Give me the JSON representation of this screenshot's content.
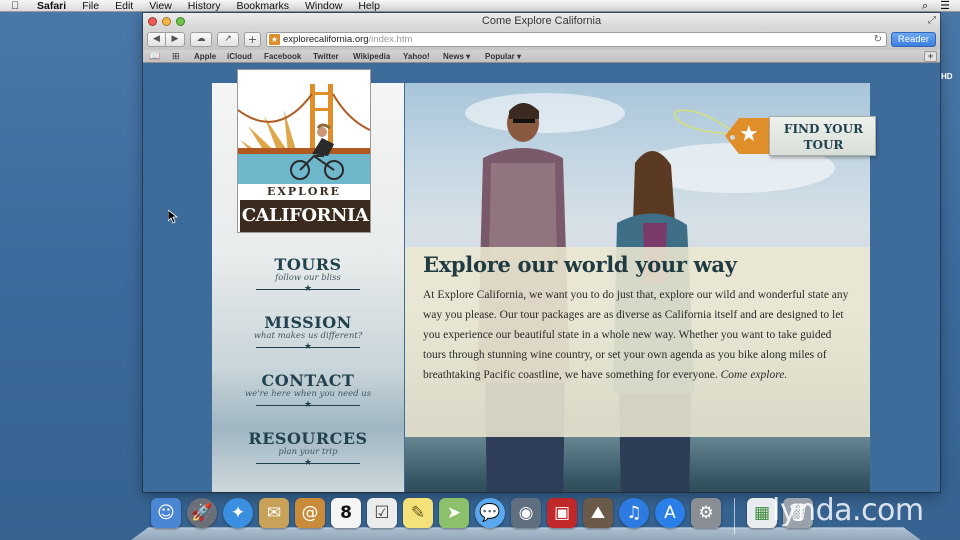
{
  "menubar": {
    "app": "Safari",
    "items": [
      "File",
      "Edit",
      "View",
      "History",
      "Bookmarks",
      "Window",
      "Help"
    ]
  },
  "window": {
    "title": "Come Explore California",
    "url_host": "explorecalifornia.org",
    "url_path": "/index.htm",
    "reader_label": "Reader",
    "new_tab_label": "+",
    "bookmarks": [
      "Apple",
      "iCloud",
      "Facebook",
      "Twitter",
      "Wikipedia",
      "Yahoo!",
      "News ▾",
      "Popular ▾"
    ],
    "hd_badge": "HD"
  },
  "site": {
    "logo_top": "EXPLORE",
    "logo_bottom": "CALIFORNIA",
    "nav": [
      {
        "title": "TOURS",
        "subtitle": "follow our bliss"
      },
      {
        "title": "MISSION",
        "subtitle": "what makes us different?"
      },
      {
        "title": "CONTACT",
        "subtitle": "we're here when you need us"
      },
      {
        "title": "RESOURCES",
        "subtitle": "plan your trip"
      }
    ],
    "tag_line1": "FIND YOUR",
    "tag_line2": "TOUR",
    "heading": "Explore our world your way",
    "body": "At Explore California, we want you to do just that, explore our wild and wonderful state any way you please. Our tour packages are as diverse as California itself and are designed to let you experience our beautiful state in a whole new way. Whether you want to take guided tours through stunning wine country, or set your own agenda as you bike along miles of breathtaking Pacific coastline, we have something for everyone.",
    "body_em": "Come explore."
  },
  "dock": {
    "items": [
      "finder",
      "launchpad",
      "safari",
      "mail-stamp",
      "contacts",
      "calendar",
      "reminders",
      "notes",
      "maps",
      "messages",
      "facetime",
      "photo-booth",
      "iphoto",
      "itunes",
      "app-store",
      "system-preferences",
      "preview",
      "trash"
    ],
    "calendar_day": "8",
    "colors": {
      "finder": "#4a86d4",
      "safari": "#3a8fe0",
      "itunes": "#2d7be0",
      "app-store": "#2a80e8"
    }
  },
  "watermark": "lynda.com",
  "colors": {
    "accent": "#e08e2a",
    "nav_text": "#20414e",
    "reader": "#3b7fe0"
  }
}
